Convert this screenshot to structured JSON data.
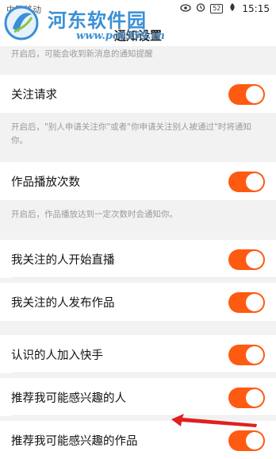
{
  "status_bar": {
    "carrier": "中国移动",
    "battery": "52",
    "time": "15:15"
  },
  "watermark": {
    "title": "河东软件园",
    "url": "www.pc0359.cn"
  },
  "header": {
    "title": "通知设置"
  },
  "top_hint": "开启后，可能会收到新消息的通知提醒",
  "settings": [
    {
      "label": "关注请求",
      "enabled": true,
      "hint": "开启后，\"别人申请关注你\"或者\"你申请关注别人被通过\"时将通知你。"
    },
    {
      "label": "作品播放次数",
      "enabled": true,
      "hint": "开启后，作品播放达到一定次数时会通知你。"
    },
    {
      "label": "我关注的人开始直播",
      "enabled": true
    },
    {
      "label": "我关注的人发布作品",
      "enabled": true
    },
    {
      "label": "认识的人加入快手",
      "enabled": true
    },
    {
      "label": "推荐我可能感兴趣的人",
      "enabled": true
    },
    {
      "label": "推荐我可能感兴趣的作品",
      "enabled": true
    }
  ],
  "colors": {
    "toggle_on": "#ff5a12",
    "arrow": "#e02020",
    "watermark": "#3a8fd6"
  },
  "icons": {
    "status_left": [
      "eye-icon",
      "alarm-icon"
    ],
    "status_right": [
      "signal-icon",
      "battery-icon"
    ]
  }
}
